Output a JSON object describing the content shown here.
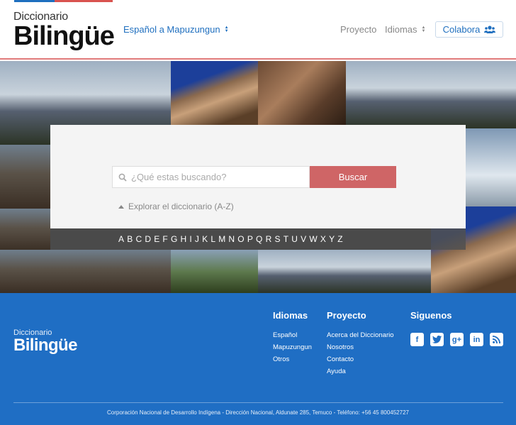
{
  "header": {
    "logo_small": "Diccionario",
    "logo_big": "Bilingüe",
    "language_pair": "Español  a Mapuzungun",
    "nav_proyecto": "Proyecto",
    "nav_idiomas": "Idiomas",
    "colabora": "Colabora"
  },
  "search": {
    "placeholder": "¿Qué estas buscando?",
    "button": "Buscar",
    "explore": "Explorar el diccionario (A-Z)"
  },
  "alphabet": [
    "A",
    "B",
    "C",
    "D",
    "E",
    "F",
    "G",
    "H",
    "I",
    "J",
    "K",
    "L",
    "M",
    "N",
    "O",
    "P",
    "Q",
    "R",
    "S",
    "T",
    "U",
    "V",
    "W",
    "X",
    "Y",
    "Z"
  ],
  "footer": {
    "logo_small": "Diccionario",
    "logo_big": "Bilingüe",
    "idiomas_title": "Idiomas",
    "idiomas_links": [
      "Español",
      "Mapuzungun",
      "Otros"
    ],
    "proyecto_title": "Proyecto",
    "proyecto_links": [
      "Acerca del Diccionario",
      "Nosotros",
      "Contacto",
      "Ayuda"
    ],
    "siguenos_title": "Siguenos",
    "social": [
      "facebook-icon",
      "twitter-icon",
      "google-plus-icon",
      "linkedin-icon",
      "rss-icon"
    ],
    "address": "Corporación Nacional de Desarrollo Indígena - Dirección Nacional, Aldunate 285, Temuco  - Teléfono: +56 45 800452727"
  },
  "colors": {
    "brand_blue": "#1f6ec4",
    "button_red": "#cf6566"
  }
}
